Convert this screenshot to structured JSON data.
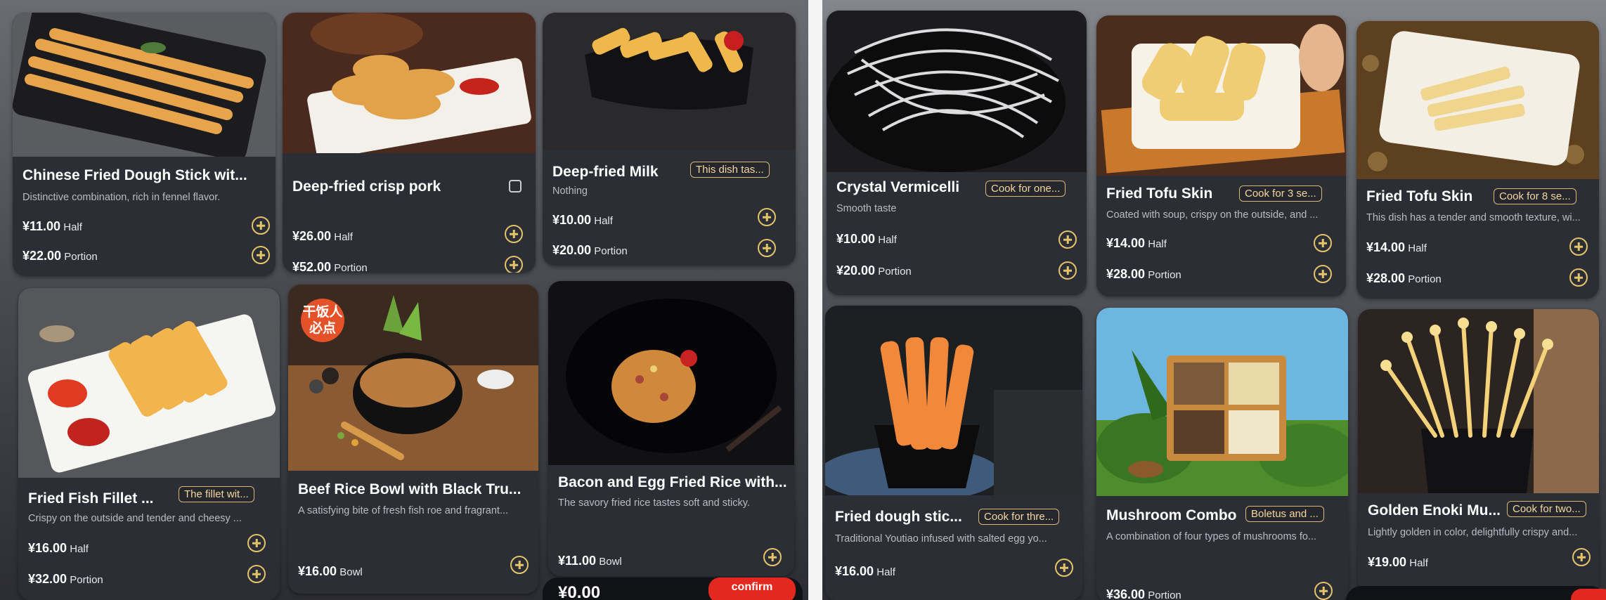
{
  "currency": "¥",
  "left_panel": {
    "cards": [
      {
        "name": "Chinese Fried Dough Stick wit...",
        "desc": "Distinctive combination, rich in fennel flavor.",
        "prices": [
          {
            "amount": "11.00",
            "unit": "Half"
          },
          {
            "amount": "22.00",
            "unit": "Portion"
          }
        ]
      },
      {
        "name": "Deep-fried crisp pork",
        "desc": "",
        "prices": [
          {
            "amount": "26.00",
            "unit": "Half"
          },
          {
            "amount": "52.00",
            "unit": "Portion"
          }
        ]
      },
      {
        "name": "Deep-fried Milk",
        "tag": "This dish tas...",
        "desc": "Nothing",
        "prices": [
          {
            "amount": "10.00",
            "unit": "Half"
          },
          {
            "amount": "20.00",
            "unit": "Portion"
          }
        ]
      },
      {
        "name": "Fried Fish Fillet ...",
        "tag": "The fillet wit...",
        "desc": "Crispy on the outside and tender and cheesy ...",
        "prices": [
          {
            "amount": "16.00",
            "unit": "Half"
          },
          {
            "amount": "32.00",
            "unit": "Portion"
          }
        ]
      },
      {
        "name": "Beef Rice Bowl with Black Tru...",
        "seal": "干饭人\n必点",
        "desc": "A satisfying bite of fresh fish roe and fragrant...",
        "prices": [
          {
            "amount": "16.00",
            "unit": "Bowl"
          }
        ]
      },
      {
        "name": "Bacon and Egg Fried Rice with...",
        "desc": "The savory fried rice tastes soft and sticky.",
        "prices": [
          {
            "amount": "11.00",
            "unit": "Bowl"
          }
        ]
      }
    ],
    "cart": {
      "total": "¥0.00",
      "confirm_label": "confirm"
    }
  },
  "right_panel": {
    "cards": [
      {
        "name": "Crystal Vermicelli",
        "tag": "Cook for one...",
        "desc": "Smooth taste",
        "prices": [
          {
            "amount": "10.00",
            "unit": "Half"
          },
          {
            "amount": "20.00",
            "unit": "Portion"
          }
        ]
      },
      {
        "name": "Fried Tofu Skin",
        "tag": "Cook for 3 se...",
        "desc": "Coated with soup, crispy on the outside, and ...",
        "prices": [
          {
            "amount": "14.00",
            "unit": "Half"
          },
          {
            "amount": "28.00",
            "unit": "Portion"
          }
        ]
      },
      {
        "name": "Fried Tofu Skin",
        "tag": "Cook for 8 se...",
        "desc": "This dish has a tender and smooth texture, wi...",
        "prices": [
          {
            "amount": "14.00",
            "unit": "Half"
          },
          {
            "amount": "28.00",
            "unit": "Portion"
          }
        ]
      },
      {
        "name": "Fried dough stic...",
        "tag": "Cook for thre...",
        "desc": "Traditional Youtiao infused with salted egg yo...",
        "prices": [
          {
            "amount": "16.00",
            "unit": "Half"
          }
        ]
      },
      {
        "name": "Mushroom Combo",
        "tag": "Boletus and ...",
        "desc": "A combination of four types of mushrooms fo...",
        "prices": [
          {
            "amount": "36.00",
            "unit": "Portion"
          }
        ]
      },
      {
        "name": "Golden Enoki Mu...",
        "tag": "Cook for two...",
        "desc": "Lightly golden in color, delightfully crispy and...",
        "prices": [
          {
            "amount": "19.00",
            "unit": "Half"
          }
        ]
      }
    ]
  },
  "colors": {
    "accent": "#e3c46a",
    "card_bg": "#2c2e35",
    "confirm": "#e3281f",
    "tag_border": "#d9b877"
  },
  "icons": {
    "add": "add-circle-icon"
  }
}
